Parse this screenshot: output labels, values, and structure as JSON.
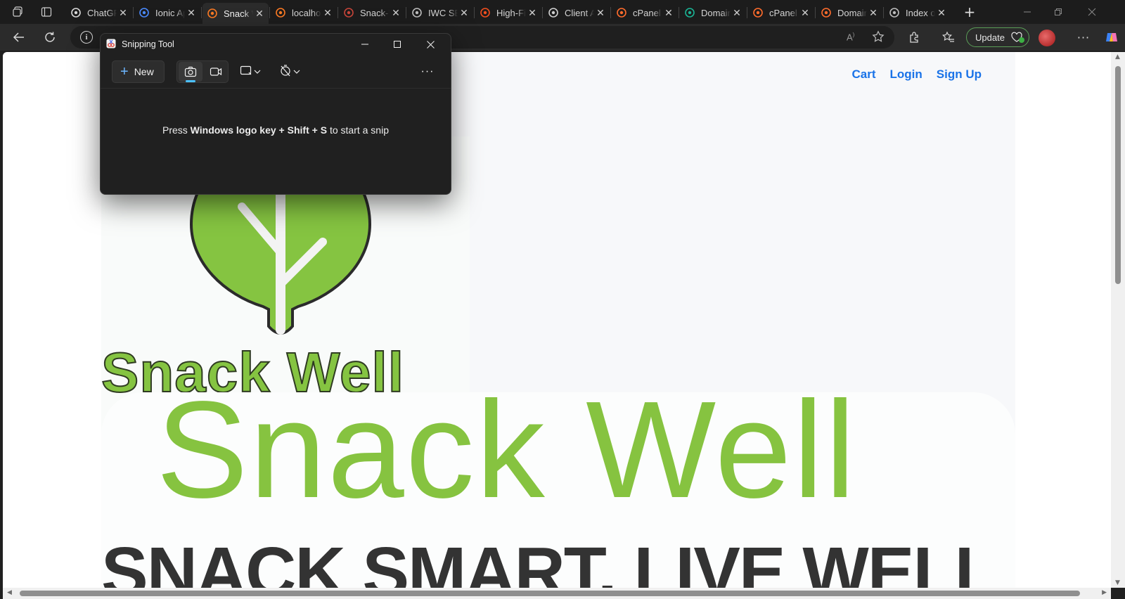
{
  "browser": {
    "tabs": [
      {
        "label": "ChatGPT",
        "icon": "chatgpt-icon",
        "active": false
      },
      {
        "label": "Ionic App",
        "icon": "ionic-icon",
        "active": false
      },
      {
        "label": "Snack Well",
        "icon": "xampp-icon",
        "active": true
      },
      {
        "label": "localhost",
        "icon": "xampp-icon",
        "active": false
      },
      {
        "label": "Snack-Well",
        "icon": "pdf-icon",
        "active": false
      },
      {
        "label": "IWC SEO",
        "icon": "globe-icon",
        "active": false
      },
      {
        "label": "High-Fidelity",
        "icon": "figma-icon",
        "active": false
      },
      {
        "label": "Client Area",
        "icon": "site-icon",
        "active": false
      },
      {
        "label": "cPanel",
        "icon": "cpanel-icon",
        "active": false
      },
      {
        "label": "Domains",
        "icon": "domain-icon",
        "active": false
      },
      {
        "label": "cPanel",
        "icon": "cpanel-icon",
        "active": false
      },
      {
        "label": "Domains",
        "icon": "cpanel-icon",
        "active": false
      },
      {
        "label": "Index of",
        "icon": "globe-icon",
        "active": false
      }
    ],
    "update_label": "Update"
  },
  "snipping_tool": {
    "title": "Snipping Tool",
    "new_label": "New",
    "hint_prefix": "Press ",
    "hint_key1": "Windows logo key",
    "hint_plus1": " + ",
    "hint_key2": "Shift",
    "hint_plus2": " + ",
    "hint_key3": "S",
    "hint_suffix": " to start a snip"
  },
  "page": {
    "nav": {
      "cart": "Cart",
      "login": "Login",
      "signup": "Sign Up"
    },
    "logo_text": "Snack Well",
    "hero_title": "Snack Well",
    "hero_subtitle": "SNACK SMART, LIVE WELL",
    "colors": {
      "brand_green": "#86c340",
      "link_blue": "#1a73e8",
      "dark_text": "#333333"
    }
  }
}
